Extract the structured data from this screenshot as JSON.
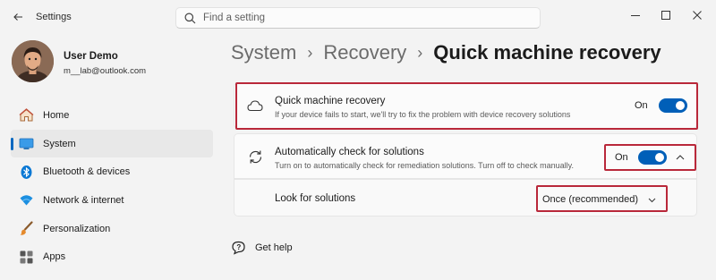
{
  "window": {
    "app_title": "Settings"
  },
  "search": {
    "placeholder": "Find a setting"
  },
  "profile": {
    "name": "User Demo",
    "email": "m__lab@outlook.com"
  },
  "sidebar": {
    "items": [
      {
        "label": "Home",
        "icon": "home-icon",
        "selected": false
      },
      {
        "label": "System",
        "icon": "system-icon",
        "selected": true
      },
      {
        "label": "Bluetooth & devices",
        "icon": "bluetooth-icon",
        "selected": false
      },
      {
        "label": "Network & internet",
        "icon": "wifi-icon",
        "selected": false
      },
      {
        "label": "Personalization",
        "icon": "brush-icon",
        "selected": false
      },
      {
        "label": "Apps",
        "icon": "apps-icon",
        "selected": false
      }
    ]
  },
  "breadcrumb": {
    "items": [
      "System",
      "Recovery",
      "Quick machine recovery"
    ]
  },
  "settings": {
    "quick_recovery": {
      "title": "Quick machine recovery",
      "description": "If your device fails to start, we'll try to fix the problem with device recovery solutions",
      "state_label": "On",
      "enabled": true
    },
    "auto_check": {
      "title": "Automatically check for solutions",
      "description": "Turn on to automatically check for remediation solutions. Turn off to check manually.",
      "state_label": "On",
      "enabled": true,
      "expanded": true
    },
    "look_for_solutions": {
      "label": "Look for solutions",
      "selected_value": "Once (recommended)"
    }
  },
  "help": {
    "label": "Get help"
  },
  "colors": {
    "accent": "#005fb8",
    "highlight": "#b9283a",
    "background": "#f3f3f3"
  }
}
